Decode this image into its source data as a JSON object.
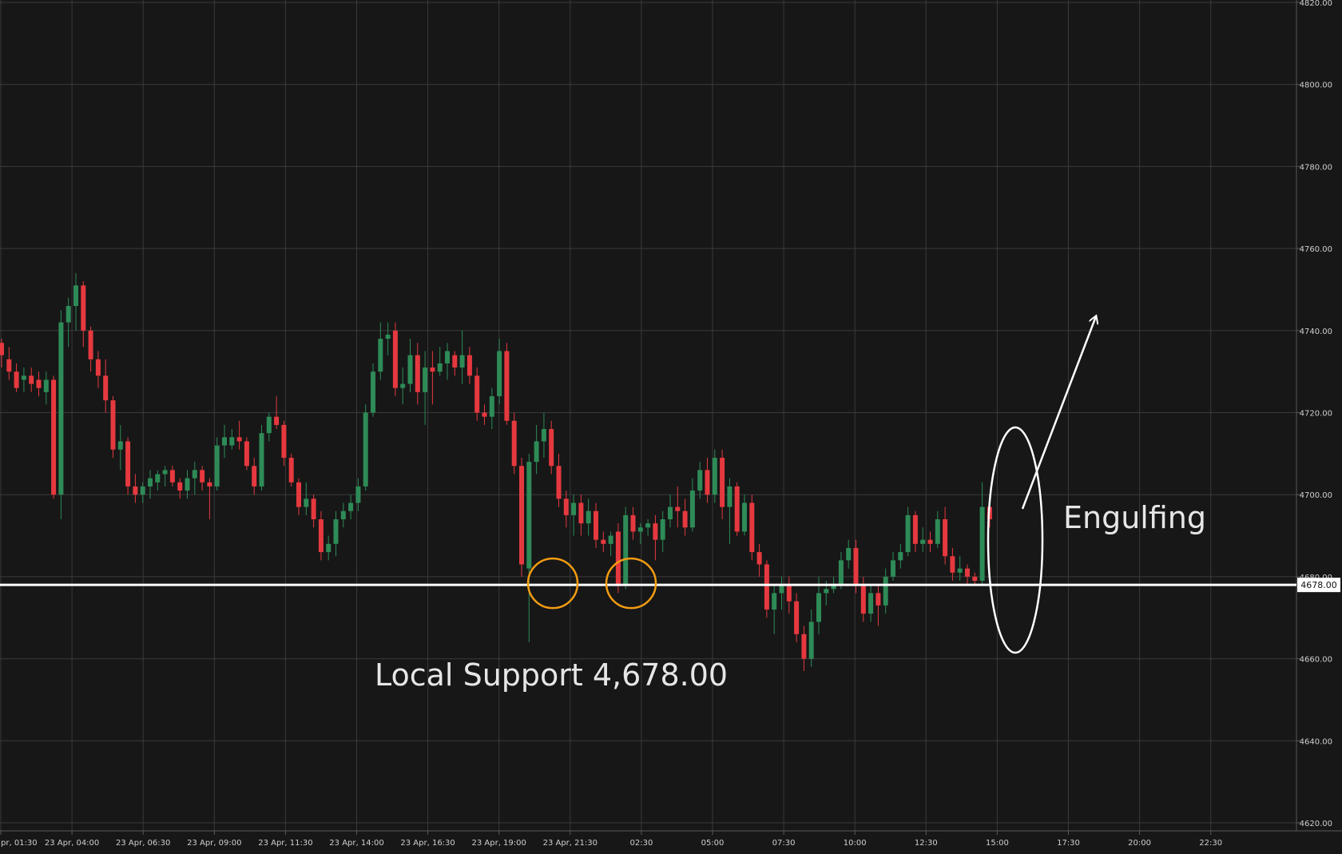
{
  "chart_data": {
    "type": "candlestick",
    "title": "",
    "xlabel": "",
    "ylabel": "",
    "ylim": [
      4617,
      4820
    ],
    "y_ticks": [
      "4620.00",
      "4640.00",
      "4660.00",
      "4680.00",
      "4700.00",
      "4720.00",
      "4740.00",
      "4760.00",
      "4780.00",
      "4800.00",
      "4820.00"
    ],
    "x_ticks": [
      "pr, 01:30",
      "23 Apr, 04:00",
      "23 Apr, 06:30",
      "23 Apr, 09:00",
      "23 Apr, 11:30",
      "23 Apr, 14:00",
      "23 Apr, 16:30",
      "23 Apr, 19:00",
      "23 Apr, 21:30",
      "02:30",
      "05:00",
      "07:30",
      "10:00",
      "12:30",
      "15:00",
      "17:30",
      "20:00",
      "22:30"
    ],
    "grid": true,
    "up_color": "#2e8b57",
    "down_color": "#e5393f",
    "candles_ohlc": [
      [
        4737,
        4738,
        4731,
        4734
      ],
      [
        4733,
        4736,
        4728,
        4730
      ],
      [
        4730,
        4732,
        4725,
        4726
      ],
      [
        4728,
        4731,
        4725,
        4729
      ],
      [
        4729,
        4731,
        4725,
        4727
      ],
      [
        4728,
        4730,
        4724,
        4726
      ],
      [
        4725,
        4730,
        4722,
        4728
      ],
      [
        4728,
        4729,
        4699,
        4700
      ],
      [
        4700,
        4745,
        4694,
        4742
      ],
      [
        4742,
        4748,
        4736,
        4746
      ],
      [
        4746,
        4754,
        4740,
        4751
      ],
      [
        4751,
        4752,
        4736,
        4740
      ],
      [
        4740,
        4741,
        4730,
        4733
      ],
      [
        4733,
        4735,
        4726,
        4729
      ],
      [
        4729,
        4733,
        4720,
        4723
      ],
      [
        4723,
        4724,
        4709,
        4711
      ],
      [
        4711,
        4717,
        4706,
        4713
      ],
      [
        4713,
        4714,
        4700,
        4702
      ],
      [
        4702,
        4705,
        4698,
        4700
      ],
      [
        4700,
        4703,
        4698,
        4702
      ],
      [
        4702,
        4706,
        4699,
        4704
      ],
      [
        4703,
        4706,
        4701,
        4705
      ],
      [
        4705,
        4707,
        4702,
        4706
      ],
      [
        4706,
        4707,
        4702,
        4703
      ],
      [
        4703,
        4704,
        4699,
        4701
      ],
      [
        4701,
        4706,
        4699,
        4704
      ],
      [
        4704,
        4708,
        4700,
        4706
      ],
      [
        4706,
        4707,
        4701,
        4703
      ],
      [
        4703,
        4704,
        4694,
        4702
      ],
      [
        4702,
        4714,
        4701,
        4712
      ],
      [
        4712,
        4717,
        4709,
        4714
      ],
      [
        4712,
        4716,
        4711,
        4714
      ],
      [
        4714,
        4718,
        4711,
        4713
      ],
      [
        4713,
        4714,
        4706,
        4707
      ],
      [
        4707,
        4709,
        4700,
        4702
      ],
      [
        4702,
        4717,
        4701,
        4715
      ],
      [
        4715,
        4720,
        4713,
        4719
      ],
      [
        4719,
        4724,
        4716,
        4717
      ],
      [
        4717,
        4718,
        4707,
        4709
      ],
      [
        4709,
        4710,
        4702,
        4703
      ],
      [
        4703,
        4704,
        4695,
        4697
      ],
      [
        4697,
        4703,
        4695,
        4699
      ],
      [
        4699,
        4700,
        4692,
        4694
      ],
      [
        4694,
        4696,
        4684,
        4686
      ],
      [
        4686,
        4690,
        4684,
        4688
      ],
      [
        4688,
        4696,
        4685,
        4694
      ],
      [
        4694,
        4698,
        4692,
        4696
      ],
      [
        4696,
        4700,
        4694,
        4698
      ],
      [
        4698,
        4704,
        4696,
        4702
      ],
      [
        4702,
        4722,
        4701,
        4720
      ],
      [
        4720,
        4732,
        4719,
        4730
      ],
      [
        4730,
        4742,
        4728,
        4738
      ],
      [
        4738,
        4742,
        4734,
        4739
      ],
      [
        4740,
        4742,
        4724,
        4726
      ],
      [
        4726,
        4731,
        4722,
        4727
      ],
      [
        4727,
        4738,
        4725,
        4734
      ],
      [
        4734,
        4737,
        4722,
        4725
      ],
      [
        4725,
        4735,
        4717,
        4731
      ],
      [
        4731,
        4735,
        4722,
        4730
      ],
      [
        4730,
        4736,
        4729,
        4732
      ],
      [
        4732,
        4737,
        4728,
        4735
      ],
      [
        4734,
        4735,
        4729,
        4731
      ],
      [
        4731,
        4740,
        4727,
        4734
      ],
      [
        4734,
        4736,
        4727,
        4729
      ],
      [
        4729,
        4731,
        4718,
        4720
      ],
      [
        4720,
        4722,
        4717,
        4719
      ],
      [
        4719,
        4726,
        4716,
        4724
      ],
      [
        4724,
        4738,
        4722,
        4735
      ],
      [
        4735,
        4737,
        4717,
        4718
      ],
      [
        4718,
        4720,
        4705,
        4707
      ],
      [
        4707,
        4709,
        4680,
        4683
      ],
      [
        4682,
        4710,
        4664,
        4708
      ],
      [
        4708,
        4717,
        4705,
        4713
      ],
      [
        4713,
        4720,
        4709,
        4716
      ],
      [
        4716,
        4718,
        4705,
        4707
      ],
      [
        4707,
        4710,
        4697,
        4699
      ],
      [
        4699,
        4701,
        4692,
        4695
      ],
      [
        4695,
        4700,
        4690,
        4698
      ],
      [
        4698,
        4700,
        4690,
        4693
      ],
      [
        4693,
        4699,
        4690,
        4696
      ],
      [
        4696,
        4698,
        4687,
        4689
      ],
      [
        4689,
        4691,
        4686,
        4688
      ],
      [
        4688,
        4691,
        4685,
        4690
      ],
      [
        4691,
        4693,
        4676,
        4678
      ],
      [
        4678,
        4697,
        4677,
        4695
      ],
      [
        4695,
        4697,
        4689,
        4691
      ],
      [
        4691,
        4693,
        4688,
        4692
      ],
      [
        4692,
        4694,
        4690,
        4693
      ],
      [
        4693,
        4695,
        4684,
        4689
      ],
      [
        4689,
        4696,
        4686,
        4694
      ],
      [
        4694,
        4700,
        4692,
        4697
      ],
      [
        4697,
        4702,
        4692,
        4696
      ],
      [
        4696,
        4699,
        4690,
        4692
      ],
      [
        4692,
        4704,
        4691,
        4701
      ],
      [
        4701,
        4708,
        4699,
        4706
      ],
      [
        4706,
        4709,
        4698,
        4700
      ],
      [
        4700,
        4711,
        4698,
        4709
      ],
      [
        4709,
        4711,
        4694,
        4697
      ],
      [
        4697,
        4704,
        4688,
        4702
      ],
      [
        4702,
        4703,
        4690,
        4691
      ],
      [
        4691,
        4700,
        4690,
        4698
      ],
      [
        4698,
        4700,
        4684,
        4686
      ],
      [
        4686,
        4688,
        4680,
        4683
      ],
      [
        4683,
        4684,
        4670,
        4672
      ],
      [
        4672,
        4678,
        4666,
        4676
      ],
      [
        4676,
        4680,
        4672,
        4678
      ],
      [
        4678,
        4680,
        4671,
        4674
      ],
      [
        4674,
        4676,
        4664,
        4666
      ],
      [
        4666,
        4668,
        4657,
        4660
      ],
      [
        4660,
        4672,
        4658,
        4669
      ],
      [
        4669,
        4680,
        4666,
        4676
      ],
      [
        4676,
        4679,
        4673,
        4677
      ],
      [
        4677,
        4680,
        4676,
        4678
      ],
      [
        4678,
        4686,
        4677,
        4684
      ],
      [
        4684,
        4689,
        4682,
        4687
      ],
      [
        4687,
        4689,
        4676,
        4678
      ],
      [
        4678,
        4680,
        4669,
        4671
      ],
      [
        4671,
        4678,
        4669,
        4676
      ],
      [
        4676,
        4678,
        4668,
        4673
      ],
      [
        4673,
        4682,
        4671,
        4680
      ],
      [
        4680,
        4686,
        4679,
        4684
      ],
      [
        4684,
        4688,
        4682,
        4686
      ],
      [
        4686,
        4697,
        4685,
        4695
      ],
      [
        4695,
        4696,
        4686,
        4688
      ],
      [
        4688,
        4692,
        4686,
        4689
      ],
      [
        4689,
        4691,
        4686,
        4688
      ],
      [
        4688,
        4696,
        4687,
        4694
      ],
      [
        4694,
        4697,
        4683,
        4685
      ],
      [
        4685,
        4687,
        4679,
        4681
      ],
      [
        4681,
        4685,
        4679,
        4682
      ],
      [
        4682,
        4683,
        4678,
        4680
      ],
      [
        4680,
        4681,
        4678,
        4679
      ],
      [
        4679,
        4703,
        4678,
        4697
      ],
      [
        4697,
        4700,
        4692,
        4694
      ]
    ],
    "support_level": {
      "value": 4678.0,
      "label": "4678.00"
    },
    "annotations": [
      {
        "text": "Local Support 4,678.00"
      },
      {
        "text": "Engulfing"
      }
    ]
  }
}
